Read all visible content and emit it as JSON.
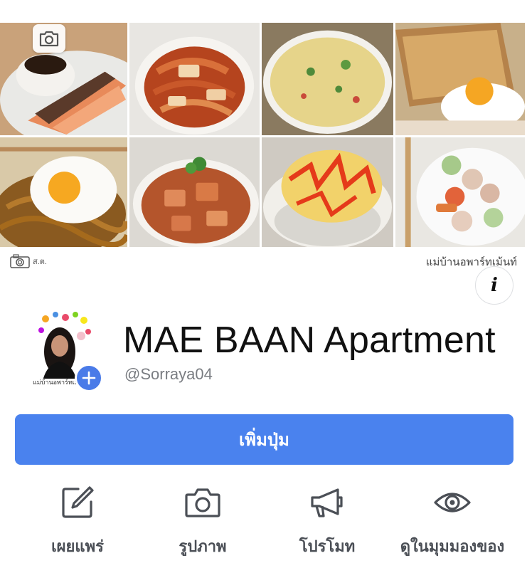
{
  "cover": {
    "watermark_left": "ส.ต.",
    "watermark_right": "แม่บ้านอพาร์ทเม้นท์"
  },
  "info": {
    "icon": "info-icon",
    "glyph": "i"
  },
  "profile": {
    "name": "MAE BAAN Apartment",
    "handle": "@Sorraya04",
    "avatar_caption": "แม่บ้านอพาร์ทเม้น"
  },
  "cta": {
    "label": "เพิ่มปุ่ม",
    "color": "#4a82ee"
  },
  "actions": [
    {
      "icon": "edit-icon",
      "label": "เผยแพร่"
    },
    {
      "icon": "camera-icon",
      "label": "รูปภาพ"
    },
    {
      "icon": "megaphone-icon",
      "label": "โปรโมท"
    },
    {
      "icon": "eye-icon",
      "label": "ดูในมุมมองของ"
    }
  ],
  "colors": {
    "accent": "#4a82ee",
    "icon_gray": "#4b4f56"
  }
}
